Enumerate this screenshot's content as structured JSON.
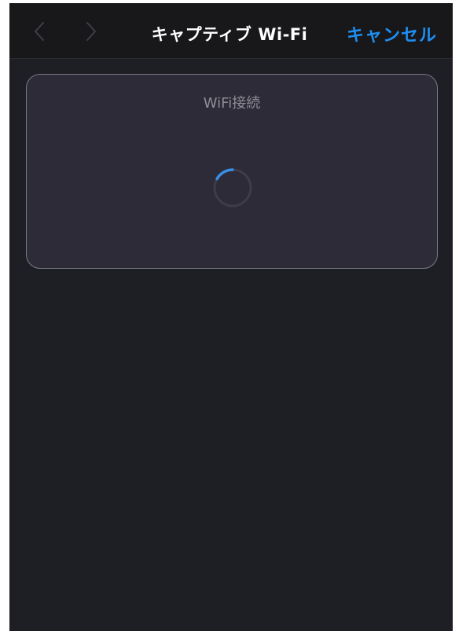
{
  "navbar": {
    "title": "キャプティブ Wi-Fi",
    "cancel_label": "キャンセル",
    "back_icon": "chevron-left-icon",
    "forward_icon": "chevron-right-icon"
  },
  "card": {
    "title": "WiFi接続",
    "status_icon": "loading-spinner-icon"
  },
  "colors": {
    "background": "#1e1e25",
    "navbar": "#18181b",
    "card": "#2c2b37",
    "accent": "#1f8ef1",
    "spinner_track": "#3d3c48"
  }
}
